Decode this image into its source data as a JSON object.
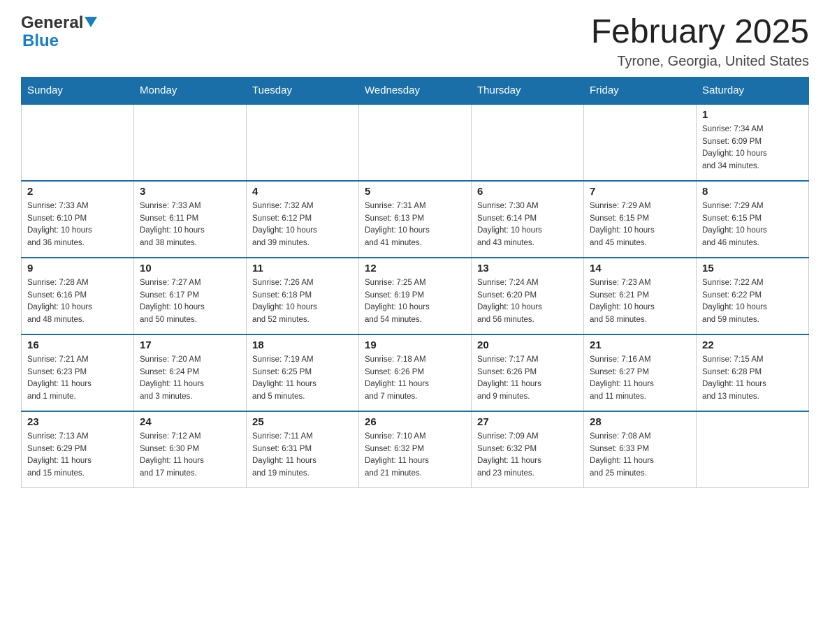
{
  "header": {
    "logo_general": "General",
    "logo_blue": "Blue",
    "month_title": "February 2025",
    "location": "Tyrone, Georgia, United States"
  },
  "days_of_week": [
    "Sunday",
    "Monday",
    "Tuesday",
    "Wednesday",
    "Thursday",
    "Friday",
    "Saturday"
  ],
  "weeks": [
    {
      "days": [
        {
          "number": "",
          "info": "",
          "empty": true
        },
        {
          "number": "",
          "info": "",
          "empty": true
        },
        {
          "number": "",
          "info": "",
          "empty": true
        },
        {
          "number": "",
          "info": "",
          "empty": true
        },
        {
          "number": "",
          "info": "",
          "empty": true
        },
        {
          "number": "",
          "info": "",
          "empty": true
        },
        {
          "number": "1",
          "info": "Sunrise: 7:34 AM\nSunset: 6:09 PM\nDaylight: 10 hours\nand 34 minutes.",
          "empty": false
        }
      ]
    },
    {
      "days": [
        {
          "number": "2",
          "info": "Sunrise: 7:33 AM\nSunset: 6:10 PM\nDaylight: 10 hours\nand 36 minutes.",
          "empty": false
        },
        {
          "number": "3",
          "info": "Sunrise: 7:33 AM\nSunset: 6:11 PM\nDaylight: 10 hours\nand 38 minutes.",
          "empty": false
        },
        {
          "number": "4",
          "info": "Sunrise: 7:32 AM\nSunset: 6:12 PM\nDaylight: 10 hours\nand 39 minutes.",
          "empty": false
        },
        {
          "number": "5",
          "info": "Sunrise: 7:31 AM\nSunset: 6:13 PM\nDaylight: 10 hours\nand 41 minutes.",
          "empty": false
        },
        {
          "number": "6",
          "info": "Sunrise: 7:30 AM\nSunset: 6:14 PM\nDaylight: 10 hours\nand 43 minutes.",
          "empty": false
        },
        {
          "number": "7",
          "info": "Sunrise: 7:29 AM\nSunset: 6:15 PM\nDaylight: 10 hours\nand 45 minutes.",
          "empty": false
        },
        {
          "number": "8",
          "info": "Sunrise: 7:29 AM\nSunset: 6:15 PM\nDaylight: 10 hours\nand 46 minutes.",
          "empty": false
        }
      ]
    },
    {
      "days": [
        {
          "number": "9",
          "info": "Sunrise: 7:28 AM\nSunset: 6:16 PM\nDaylight: 10 hours\nand 48 minutes.",
          "empty": false
        },
        {
          "number": "10",
          "info": "Sunrise: 7:27 AM\nSunset: 6:17 PM\nDaylight: 10 hours\nand 50 minutes.",
          "empty": false
        },
        {
          "number": "11",
          "info": "Sunrise: 7:26 AM\nSunset: 6:18 PM\nDaylight: 10 hours\nand 52 minutes.",
          "empty": false
        },
        {
          "number": "12",
          "info": "Sunrise: 7:25 AM\nSunset: 6:19 PM\nDaylight: 10 hours\nand 54 minutes.",
          "empty": false
        },
        {
          "number": "13",
          "info": "Sunrise: 7:24 AM\nSunset: 6:20 PM\nDaylight: 10 hours\nand 56 minutes.",
          "empty": false
        },
        {
          "number": "14",
          "info": "Sunrise: 7:23 AM\nSunset: 6:21 PM\nDaylight: 10 hours\nand 58 minutes.",
          "empty": false
        },
        {
          "number": "15",
          "info": "Sunrise: 7:22 AM\nSunset: 6:22 PM\nDaylight: 10 hours\nand 59 minutes.",
          "empty": false
        }
      ]
    },
    {
      "days": [
        {
          "number": "16",
          "info": "Sunrise: 7:21 AM\nSunset: 6:23 PM\nDaylight: 11 hours\nand 1 minute.",
          "empty": false
        },
        {
          "number": "17",
          "info": "Sunrise: 7:20 AM\nSunset: 6:24 PM\nDaylight: 11 hours\nand 3 minutes.",
          "empty": false
        },
        {
          "number": "18",
          "info": "Sunrise: 7:19 AM\nSunset: 6:25 PM\nDaylight: 11 hours\nand 5 minutes.",
          "empty": false
        },
        {
          "number": "19",
          "info": "Sunrise: 7:18 AM\nSunset: 6:26 PM\nDaylight: 11 hours\nand 7 minutes.",
          "empty": false
        },
        {
          "number": "20",
          "info": "Sunrise: 7:17 AM\nSunset: 6:26 PM\nDaylight: 11 hours\nand 9 minutes.",
          "empty": false
        },
        {
          "number": "21",
          "info": "Sunrise: 7:16 AM\nSunset: 6:27 PM\nDaylight: 11 hours\nand 11 minutes.",
          "empty": false
        },
        {
          "number": "22",
          "info": "Sunrise: 7:15 AM\nSunset: 6:28 PM\nDaylight: 11 hours\nand 13 minutes.",
          "empty": false
        }
      ]
    },
    {
      "days": [
        {
          "number": "23",
          "info": "Sunrise: 7:13 AM\nSunset: 6:29 PM\nDaylight: 11 hours\nand 15 minutes.",
          "empty": false
        },
        {
          "number": "24",
          "info": "Sunrise: 7:12 AM\nSunset: 6:30 PM\nDaylight: 11 hours\nand 17 minutes.",
          "empty": false
        },
        {
          "number": "25",
          "info": "Sunrise: 7:11 AM\nSunset: 6:31 PM\nDaylight: 11 hours\nand 19 minutes.",
          "empty": false
        },
        {
          "number": "26",
          "info": "Sunrise: 7:10 AM\nSunset: 6:32 PM\nDaylight: 11 hours\nand 21 minutes.",
          "empty": false
        },
        {
          "number": "27",
          "info": "Sunrise: 7:09 AM\nSunset: 6:32 PM\nDaylight: 11 hours\nand 23 minutes.",
          "empty": false
        },
        {
          "number": "28",
          "info": "Sunrise: 7:08 AM\nSunset: 6:33 PM\nDaylight: 11 hours\nand 25 minutes.",
          "empty": false
        },
        {
          "number": "",
          "info": "",
          "empty": true
        }
      ]
    }
  ]
}
